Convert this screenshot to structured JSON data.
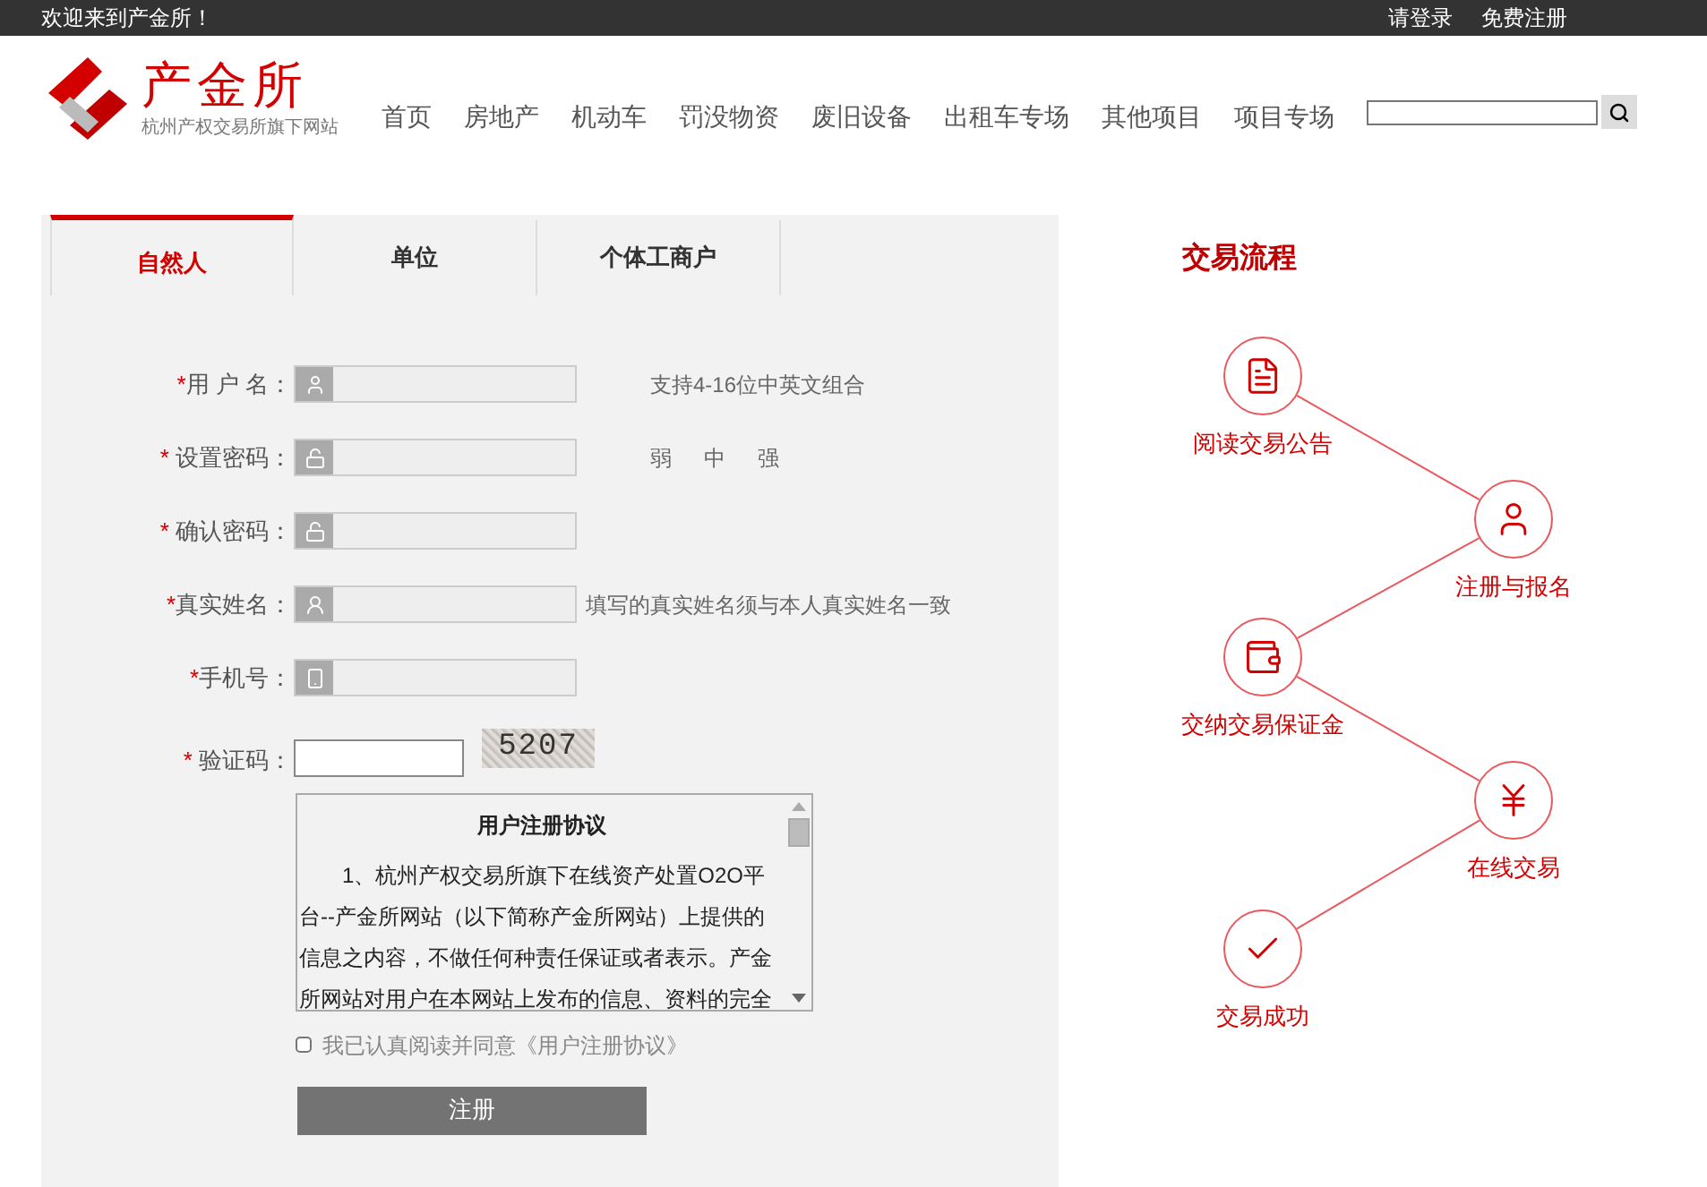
{
  "top_bar": {
    "welcome": "欢迎来到产金所！",
    "links": [
      "请登录",
      "免费注册"
    ]
  },
  "header": {
    "logo_name": "产金所",
    "logo_subtitle": "杭州产权交易所旗下网站",
    "nav": [
      "首页",
      "房地产",
      "机动车",
      "罚没物资",
      "废旧设备",
      "出租车专场",
      "其他项目",
      "项目专场"
    ]
  },
  "tabs": [
    {
      "label": "自然人",
      "selected": true
    },
    {
      "label": "单位",
      "selected": false
    },
    {
      "label": "个体工商户",
      "selected": false
    }
  ],
  "fields": [
    {
      "mark": "*",
      "label": "用 户 名：",
      "kind": "user",
      "hint": "支持4-16位中英文组合"
    },
    {
      "mark": "* ",
      "label": "设置密码：",
      "kind": "lock",
      "strength": [
        "弱",
        "中",
        "强"
      ]
    },
    {
      "mark": "* ",
      "label": "确认密码：",
      "kind": "lock"
    },
    {
      "mark": "*",
      "label": "真实姓名：",
      "kind": "card",
      "note": "填写的真实姓名须与本人真实姓名一致"
    },
    {
      "mark": "*",
      "label": "手机号：",
      "kind": "phone"
    }
  ],
  "captcha": {
    "mark": "* ",
    "label": "验证码：",
    "code": "5207"
  },
  "agreement": {
    "title": "用户注册协议",
    "text": "1、杭州产权交易所旗下在线资产处置O2O平台--产金所网站（以下简称产金所网站）上提供的信息之内容，不做任何种责任保证或者表示。产金所网站对用户在本网站上发布的信息、资料的完全"
  },
  "consent": {
    "checked": false,
    "label": "我已认真阅读并同意《用户注册协议》"
  },
  "submit": "注册",
  "process": {
    "title": "交易流程",
    "steps": [
      {
        "kind": "document",
        "label": "阅读交易公告"
      },
      {
        "kind": "person",
        "label": "注册与报名"
      },
      {
        "kind": "wallet",
        "label": "交纳交易保证金"
      },
      {
        "kind": "yen",
        "label": "在线交易"
      },
      {
        "kind": "check",
        "label": "交易成功"
      }
    ]
  }
}
